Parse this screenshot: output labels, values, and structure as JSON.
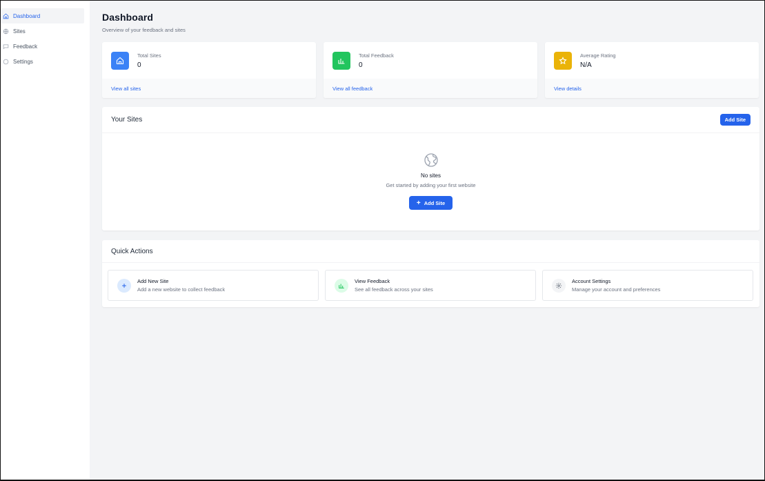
{
  "sidebar": {
    "items": [
      {
        "label": "Dashboard",
        "icon": "home-icon",
        "active": true
      },
      {
        "label": "Sites",
        "icon": "globe-icon",
        "active": false
      },
      {
        "label": "Feedback",
        "icon": "message-icon",
        "active": false
      },
      {
        "label": "Settings",
        "icon": "gear-icon",
        "active": false
      }
    ]
  },
  "header": {
    "title": "Dashboard",
    "subtitle": "Overview of your feedback and sites"
  },
  "stats": [
    {
      "label": "Total Sites",
      "value": "0",
      "link": "View all sites",
      "icon": "home-icon",
      "color": "#3b82f6"
    },
    {
      "label": "Total Feedback",
      "value": "0",
      "link": "View all feedback",
      "icon": "bar-chart-icon",
      "color": "#22c55e"
    },
    {
      "label": "Average Rating",
      "value": "N/A",
      "link": "View details",
      "icon": "star-icon",
      "color": "#eab308"
    }
  ],
  "sites": {
    "title": "Your Sites",
    "add_button": "Add Site",
    "empty_title": "No sites",
    "empty_subtitle": "Get started by adding your first website",
    "empty_button": "Add Site"
  },
  "quick_actions": {
    "title": "Quick Actions",
    "items": [
      {
        "title": "Add New Site",
        "subtitle": "Add a new website to collect feedback",
        "icon": "plus-icon",
        "color": "#2563eb",
        "bg": "#dbeafe"
      },
      {
        "title": "View Feedback",
        "subtitle": "See all feedback across your sites",
        "icon": "bar-chart-icon",
        "color": "#22c55e",
        "bg": "#dcfce7"
      },
      {
        "title": "Account Settings",
        "subtitle": "Manage your account and preferences",
        "icon": "gear-icon",
        "color": "#4b5563",
        "bg": "#f3f4f6"
      }
    ]
  },
  "colors": {
    "accent": "#2563eb",
    "sidebar_bg": "#ffffff",
    "page_bg": "#f3f4f6"
  }
}
